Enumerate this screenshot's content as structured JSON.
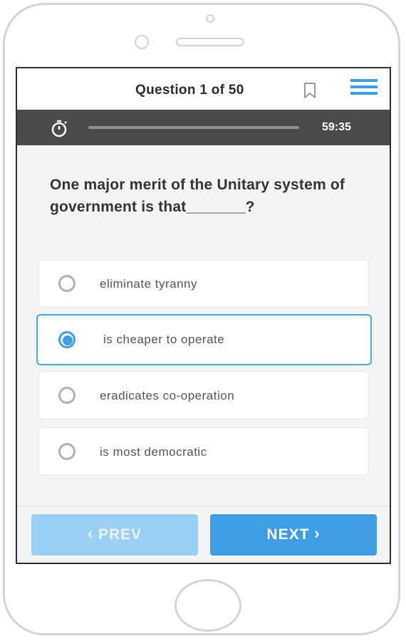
{
  "header": {
    "title": "Question 1 of 50",
    "bookmark_icon": "bookmark-icon",
    "menu_icon": "hamburger-menu-icon"
  },
  "timer": {
    "icon": "stopwatch-icon",
    "time_remaining": "59:35",
    "progress": 0
  },
  "question": {
    "text": "One major merit of the Unitary system of government is that_______?"
  },
  "options": [
    {
      "label": "eliminate tyranny",
      "selected": false
    },
    {
      "label": "is cheaper to operate",
      "selected": true
    },
    {
      "label": "eradicates co-operation",
      "selected": false
    },
    {
      "label": "is most democratic",
      "selected": false
    }
  ],
  "footer": {
    "prev_label": "PREV",
    "prev_icon": "chevron-left-icon",
    "next_label": "NEXT",
    "next_icon": "chevron-right-icon"
  },
  "colors": {
    "accent": "#3d9ee6",
    "accent_light": "#9ccff4",
    "timer_bar": "#4b4b4b",
    "background": "#f4f4f4"
  }
}
